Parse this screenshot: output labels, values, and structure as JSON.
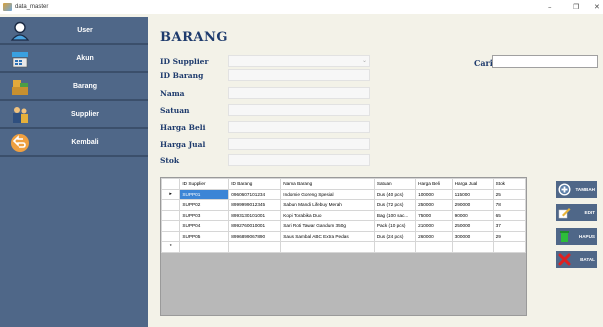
{
  "window": {
    "title": "data_master",
    "controls": {
      "minimize": "–",
      "maximize": "❐",
      "close": "✕"
    }
  },
  "sidebar": {
    "items": [
      {
        "label": "User",
        "icon": "user-icon"
      },
      {
        "label": "Akun",
        "icon": "cash-register-icon"
      },
      {
        "label": "Barang",
        "icon": "box-icon"
      },
      {
        "label": "Supplier",
        "icon": "supplier-icon"
      },
      {
        "label": "Kembali",
        "icon": "back-icon"
      }
    ]
  },
  "form": {
    "title": "BARANG",
    "labels": {
      "id_supplier": "ID Supplier",
      "id_barang": "ID Barang",
      "nama": "Nama",
      "satuan": "Satuan",
      "harga_beli": "Harga Beli",
      "harga_jual": "Harga Jual",
      "stok": "Stok"
    },
    "values": {
      "id_supplier": "",
      "id_barang": "",
      "nama": "",
      "satuan": "",
      "harga_beli": "",
      "harga_jual": "",
      "stok": ""
    },
    "search_label": "Cari",
    "search_value": ""
  },
  "grid": {
    "columns": [
      "ID Supplier",
      "ID Barang",
      "Nama Barang",
      "Satuan",
      "Harga Beli",
      "Harga Jual",
      "Stok"
    ],
    "rows": [
      [
        "SUPP01",
        "0960607101234",
        "Indomie Goreng Spesial",
        "Dus (40 pcs)",
        "100000",
        "115000",
        "25"
      ],
      [
        "SUPP02",
        "8999999012345",
        "Sabun Mandi Lifebuy Merah",
        "Dus (72 pcs)",
        "250000",
        "290000",
        "78"
      ],
      [
        "SUPP03",
        "8993130101001",
        "Kopi Torabika Duo",
        "Bag (100 sac...",
        "75000",
        "90000",
        "65"
      ],
      [
        "SUPP04",
        "8992760010001",
        "Sari Roti Tawar Gandum 350g",
        "Pack (10 pcs)",
        "210000",
        "250000",
        "37"
      ],
      [
        "SUPP05",
        "8996899067890",
        "Saus Sambal ABC Extra Pedas",
        "Dus (24 pcs)",
        "260000",
        "300000",
        "29"
      ]
    ],
    "selected_row": 0,
    "row_marker": "▸",
    "new_row_marker": "*"
  },
  "actions": {
    "tambah": "TAMBAH",
    "edit": "EDIT",
    "hapus": "HAPUS",
    "batal": "BATAL"
  },
  "colors": {
    "sidebar": "#4f6788",
    "accent": "#1e3b6d",
    "selection": "#3c85d6",
    "background": "#f3f2e8"
  }
}
